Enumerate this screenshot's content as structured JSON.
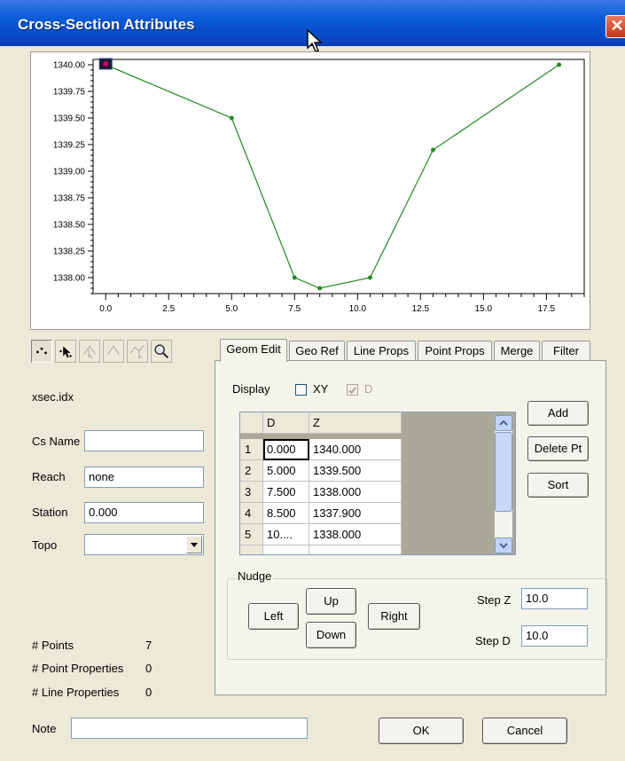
{
  "window": {
    "title": "Cross-Section Attributes",
    "close_icon": "close-icon",
    "title_color_start": "#0a3fb8",
    "title_color_end": "#3a79e6"
  },
  "chart_data": {
    "type": "line",
    "series": [
      {
        "x": [
          0.0,
          5.0,
          7.5,
          8.5,
          10.5,
          13.0,
          18.0
        ],
        "y": [
          1340.0,
          1339.5,
          1338.0,
          1337.9,
          1338.0,
          1339.2,
          1340.0
        ]
      }
    ],
    "xlim": [
      -0.5,
      19.0
    ],
    "ylim": [
      1337.85,
      1340.05
    ],
    "x_ticks": [
      "0.0",
      "2.5",
      "5.0",
      "7.5",
      "10.0",
      "12.5",
      "15.0",
      "17.5"
    ],
    "y_ticks": [
      "1340.00",
      "1339.75",
      "1339.50",
      "1339.25",
      "1339.00",
      "1338.75",
      "1338.50",
      "1338.25",
      "1338.00"
    ],
    "line_color": "#228b22",
    "selected_point_color": "#cc0066",
    "grid": false
  },
  "toolbar": [
    {
      "name": "select-points-tool-icon",
      "pressed": true
    },
    {
      "name": "move-point-tool-icon",
      "pressed": false
    },
    {
      "name": "insert-point-tool-icon",
      "pressed": false
    },
    {
      "name": "peak-tool-icon",
      "pressed": false
    },
    {
      "name": "line-select-tool-icon",
      "pressed": false
    },
    {
      "name": "zoom-icon",
      "pressed": false
    }
  ],
  "left": {
    "file_name": "xsec.idx",
    "cs_name_label": "Cs Name",
    "cs_name_value": "",
    "reach_label": "Reach",
    "reach_value": "none",
    "station_label": "Station",
    "station_value": "0.000",
    "topo_label": "Topo",
    "topo_value": "",
    "points_label": "# Points",
    "points_value": "7",
    "point_props_label": "# Point Properties",
    "point_props_value": "0",
    "line_props_label": "# Line Properties",
    "line_props_value": "0"
  },
  "tabs": [
    "Geom Edit",
    "Geo Ref",
    "Line Props",
    "Point Props",
    "Merge",
    "Filter"
  ],
  "geom": {
    "display_label": "Display",
    "xy_label": "XY",
    "xy_checked": false,
    "d_label": "D",
    "d_checked": true,
    "columns": [
      "D",
      "Z"
    ],
    "rows": [
      {
        "n": "1",
        "d": "0.000",
        "z": "1340.000"
      },
      {
        "n": "2",
        "d": "5.000",
        "z": "1339.500"
      },
      {
        "n": "3",
        "d": "7.500",
        "z": "1338.000"
      },
      {
        "n": "4",
        "d": "8.500",
        "z": "1337.900"
      },
      {
        "n": "5",
        "d": "10....",
        "z": "1338.000"
      }
    ],
    "add_label": "Add",
    "delete_label": "Delete Pt",
    "sort_label": "Sort",
    "nudge_title": "Nudge",
    "left_label": "Left",
    "up_label": "Up",
    "down_label": "Down",
    "right_label": "Right",
    "step_z_label": "Step Z",
    "step_z_value": "10.0",
    "step_d_label": "Step D",
    "step_d_value": "10.0"
  },
  "footer": {
    "note_label": "Note",
    "note_value": "",
    "ok_label": "OK",
    "cancel_label": "Cancel"
  }
}
